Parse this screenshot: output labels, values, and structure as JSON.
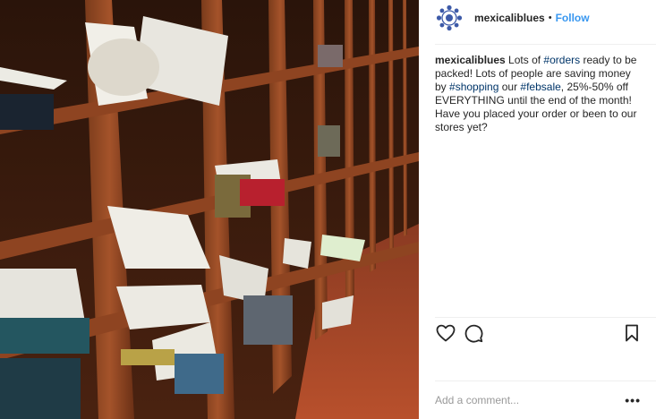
{
  "post": {
    "username": "mexicaliblues",
    "separator": "•",
    "follow_label": "Follow",
    "caption": {
      "username": "mexicaliblues",
      "parts": [
        {
          "text": " Lots of ",
          "tag": false
        },
        {
          "text": "#orders",
          "tag": true
        },
        {
          "text": " ready to be packed! Lots of people are saving money by ",
          "tag": false
        },
        {
          "text": "#shopping",
          "tag": true
        },
        {
          "text": " our ",
          "tag": false
        },
        {
          "text": "#febsale",
          "tag": true
        },
        {
          "text": ", 25%-50% off EVERYTHING until the end of the month! Have you placed your order or been to our stores yet?",
          "tag": false
        }
      ]
    }
  },
  "actions": {
    "like": "heart-icon",
    "comment": "comment-icon",
    "save": "bookmark-icon"
  },
  "comment_box": {
    "placeholder": "Add a comment...",
    "more_label": "•••"
  },
  "colors": {
    "follow": "#3897f0",
    "hashtag": "#003569",
    "avatar_brand": "#3d5aa8",
    "text": "#262626"
  }
}
